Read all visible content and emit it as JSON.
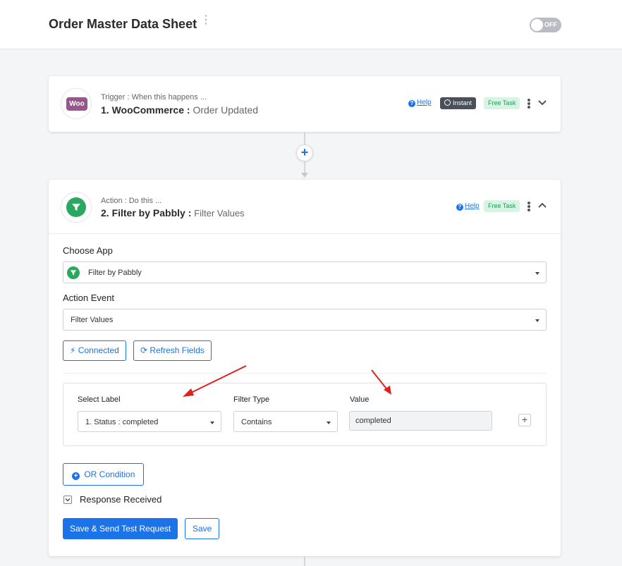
{
  "header": {
    "title": "Order Master Data Sheet",
    "toggle_label": "OFF"
  },
  "trigger": {
    "subtitle": "Trigger : When this happens ...",
    "step": "1. WooCommerce :",
    "event": "Order Updated",
    "app_logo_text": "Woo",
    "help_label": "Help",
    "instant_badge": "Instant",
    "free_badge": "Free Task"
  },
  "action": {
    "subtitle": "Action : Do this ...",
    "step": "2. Filter by Pabbly :",
    "event": "Filter Values",
    "help_label": "Help",
    "free_badge": "Free Task",
    "choose_app_label": "Choose App",
    "choose_app_value": "Filter by Pabbly",
    "action_event_label": "Action Event",
    "action_event_value": "Filter Values",
    "connected_label": "Connected",
    "refresh_label": "Refresh Fields",
    "filter": {
      "select_label_header": "Select Label",
      "select_label_value": "1. Status : completed",
      "filter_type_header": "Filter Type",
      "filter_type_value": "Contains",
      "value_header": "Value",
      "value_value": "completed"
    },
    "or_condition_label": "OR Condition",
    "response_label": "Response Received",
    "save_send_label": "Save & Send Test Request",
    "save_label": "Save"
  },
  "colors": {
    "accent": "#1a73e8",
    "filter_green": "#2ba860",
    "woo_purple": "#96588a",
    "annotation_red": "#e02020"
  }
}
